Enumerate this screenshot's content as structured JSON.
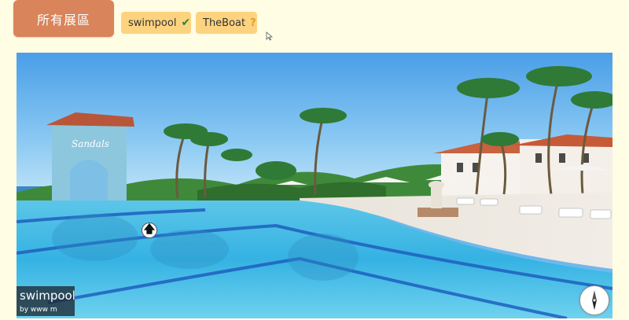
{
  "header": {
    "all_areas_label": "所有展區",
    "tags": [
      {
        "label": "swimpool",
        "icon": "check-icon",
        "icon_glyph": "✔"
      },
      {
        "label": "TheBoat",
        "icon": "question-icon",
        "icon_glyph": "?"
      }
    ]
  },
  "viewer": {
    "scene_title": "swimpool",
    "scene_author": "by www m",
    "hotspot_glyph": "🡅"
  },
  "colors": {
    "page_bg": "#fffde4",
    "all_button": "#d9845a",
    "tag_bg": "#fdd37f",
    "check": "#1f8a3a",
    "question": "#e49b2b"
  }
}
